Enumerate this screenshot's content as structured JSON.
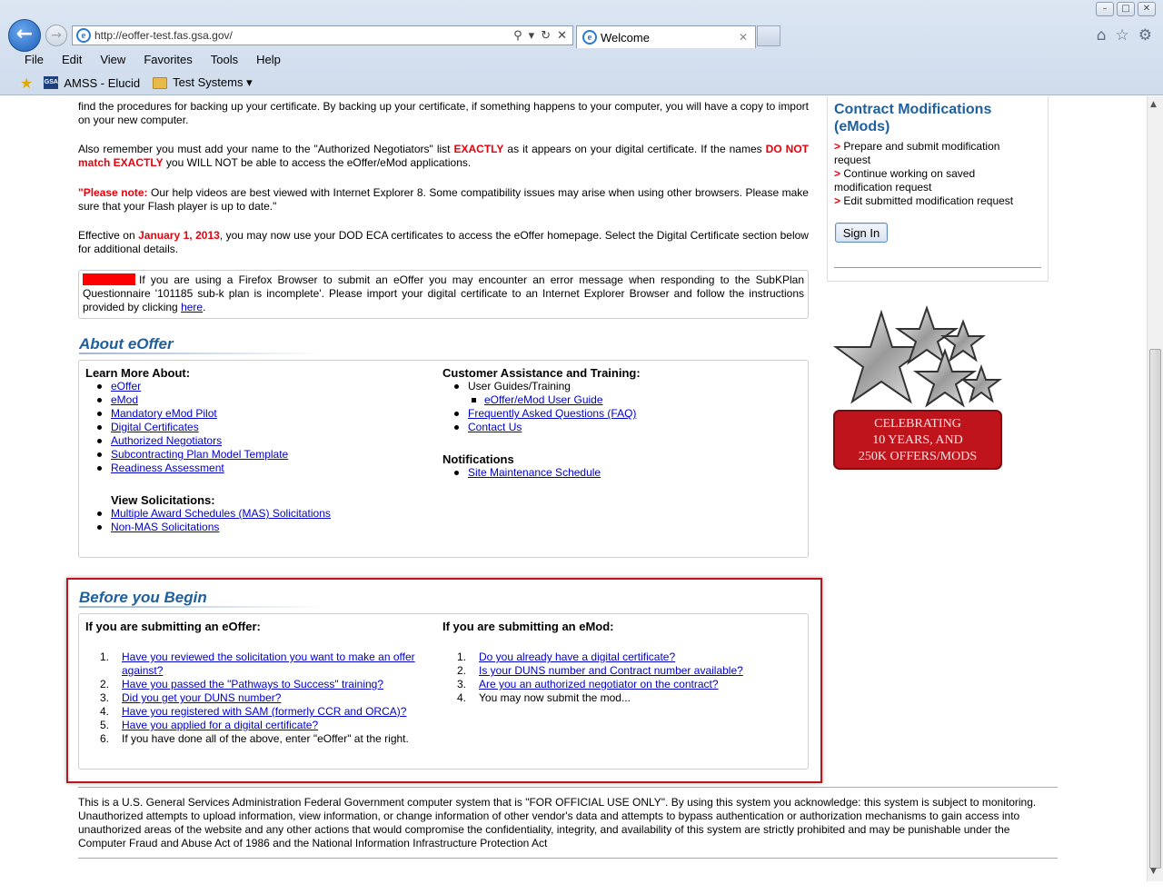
{
  "browser": {
    "window_buttons": [
      "–",
      "□",
      "✕"
    ],
    "url": "http://eoffer-test.fas.gsa.gov/",
    "tab_title": "Welcome",
    "menu": [
      "File",
      "Edit",
      "View",
      "Favorites",
      "Tools",
      "Help"
    ],
    "favorites": [
      {
        "label": "AMSS - Elucid",
        "icon": "gsa-icon"
      },
      {
        "label": "Test Systems ▾",
        "icon": "folder-icon"
      }
    ]
  },
  "intro": {
    "p1": "find the procedures for backing up your certificate. By backing up your certificate, if something happens to your computer, you will have a copy to import on your new computer.",
    "p2_a": "Also remember you must add your name to the \"Authorized Negotiators\" list ",
    "p2_exactly": "EXACTLY",
    "p2_b": " as it appears on your digital certificate. If the names ",
    "p2_notmatch": "DO NOT match EXACTLY",
    "p2_c": " you WILL NOT be able to access the eOffer/eMod applications.",
    "p3_label": "\"Please note:",
    "p3_text": " Our help videos are best viewed with Internet Explorer 8. Some compatibility issues may arise when using other browsers. Please make sure that your Flash player is up to date.\"",
    "p4_a": "Effective on ",
    "p4_date": "January 1, 2013",
    "p4_b": ", you may now use your DOD ECA certificates to access the eOffer homepage. Select the Digital Certificate section below for additional details."
  },
  "alert": {
    "text": "If you are using a Firefox Browser to submit an eOffer you may encounter an error message when responding to the SubKPlan Questionnaire '101185 sub-k plan is incomplete'. Please import your digital certificate to an Internet Explorer Browser and follow the instructions provided by clicking ",
    "link": "here",
    "end": "."
  },
  "about": {
    "title": "About eOffer",
    "learn_heading": "Learn More About:",
    "learn_links": [
      "eOffer",
      "eMod",
      "Mandatory eMod Pilot",
      "Digital Certificates",
      "Authorized Negotiators",
      "Subcontracting Plan Model Template",
      "Readiness Assessment"
    ],
    "view_heading": "View Solicitations:",
    "view_links": [
      "Multiple Award Schedules (MAS) Solicitations",
      "Non-MAS Solicitations"
    ],
    "cust_heading": "Customer Assistance and Training:",
    "cust_guides": "User Guides/Training",
    "cust_guide_link": "eOffer/eMod User Guide",
    "cust_faq": "Frequently Asked Questions (FAQ)",
    "cust_contact": "Contact Us",
    "notif_heading": "Notifications",
    "notif_link": "Site Maintenance Schedule"
  },
  "before": {
    "title": "Before you Begin",
    "eoffer_heading": "If you are submitting an eOffer:",
    "eoffer_items": [
      {
        "n": "1.",
        "text": "Have you reviewed the solicitation you want to make an offer against?",
        "link": true
      },
      {
        "n": "2.",
        "text": "Have you passed the \"Pathways to Success\" training?",
        "link": true
      },
      {
        "n": "3.",
        "text": "Did you get your DUNS number?",
        "link": true
      },
      {
        "n": "4.",
        "text": "Have you registered with SAM (formerly CCR and ORCA)?",
        "link": true
      },
      {
        "n": "5.",
        "text": "Have you applied for a digital certificate?",
        "link": true
      },
      {
        "n": "6.",
        "text": "If you have done all of the above, enter \"eOffer\" at the right.",
        "link": false
      }
    ],
    "emod_heading": "If you are submitting an eMod:",
    "emod_items": [
      {
        "n": "1.",
        "text": "Do you already have a digital certificate?",
        "link": true
      },
      {
        "n": "2.",
        "text": "Is your DUNS number and Contract number available?",
        "link": true
      },
      {
        "n": "3.",
        "text": "Are you an authorized negotiator on the contract?",
        "link": true
      },
      {
        "n": "4.",
        "text": "You may now submit the mod...",
        "link": false
      }
    ]
  },
  "emods": {
    "title": "Contract Modifications (eMods)",
    "arrow": ">",
    "items": [
      "Prepare and submit modification request",
      "Continue working on saved modification request",
      "Edit submitted modification request"
    ],
    "signin": "Sign In"
  },
  "badge": {
    "line1": "CELEBRATING",
    "line2": "10 YEARS, AND",
    "line3": "250K OFFERS/MODS"
  },
  "footer": {
    "text": "This is a U.S. General Services Administration Federal Government computer system that is \"FOR OFFICIAL USE ONLY\". By using this system you acknowledge: this system is subject to monitoring. Unauthorized attempts to upload information, view information, or change information of other vendor's data and attempts to bypass authentication or authorization mechanisms to gain access into unauthorized areas of the website and any other actions that would compromise the confidentiality, integrity, and availability of this system are strictly prohibited and may be punishable under the Computer Fraud and Abuse Act of 1986 and the National Information Infrastructure Protection Act"
  },
  "colors": {
    "accent_blue": "#1f5f9e",
    "alert_red": "#e8000b",
    "highlight_border": "#c0141c",
    "link": "#0000cc"
  }
}
